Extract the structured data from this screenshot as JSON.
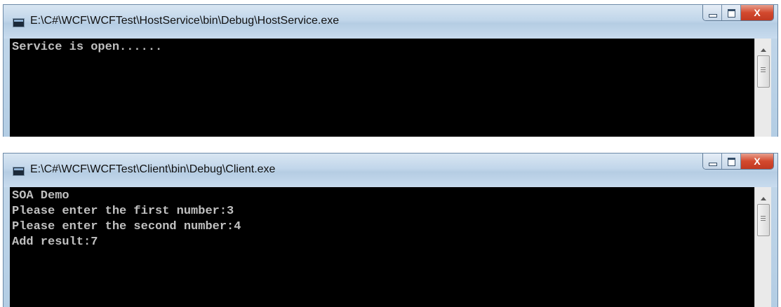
{
  "windows": [
    {
      "title": "E:\\C#\\WCF\\WCFTest\\HostService\\bin\\Debug\\HostService.exe",
      "lines": [
        "Service is open......"
      ]
    },
    {
      "title": "E:\\C#\\WCF\\WCFTest\\Client\\bin\\Debug\\Client.exe",
      "lines": [
        "SOA Demo",
        "Please enter the first number:3",
        "Please enter the second number:4",
        "Add result:7"
      ]
    }
  ],
  "caption_buttons": {
    "close_label": "X"
  },
  "colors": {
    "console_background": "#000000",
    "console_text": "#c0c0c0",
    "close_button": "#c94128"
  },
  "icons": [
    "console-app-icon",
    "minimize-icon",
    "maximize-icon",
    "close-icon",
    "scroll-up-arrow-icon",
    "scroll-thumb-grip-icon"
  ]
}
